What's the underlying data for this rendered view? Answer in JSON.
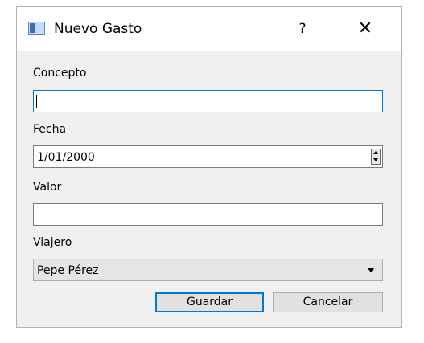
{
  "window": {
    "title": "Nuevo Gasto",
    "help_label": "?",
    "close_label": "✕"
  },
  "form": {
    "concepto_label": "Concepto",
    "concepto_value": "",
    "fecha_label": "Fecha",
    "fecha_value": "1/01/2000",
    "valor_label": "Valor",
    "valor_value": "",
    "viajero_label": "Viajero",
    "viajero_value": "Pepe Pérez"
  },
  "buttons": {
    "guardar": "Guardar",
    "cancelar": "Cancelar"
  },
  "icons": {
    "app": "window-app-icon",
    "help": "help-icon",
    "close": "close-icon",
    "spin": "spin-updown-icon",
    "dropdown": "chevron-down-icon"
  },
  "colors": {
    "focus": "#0078d7",
    "dialog_bg": "#f0f0f0",
    "titlebar_bg": "#ffffff"
  }
}
